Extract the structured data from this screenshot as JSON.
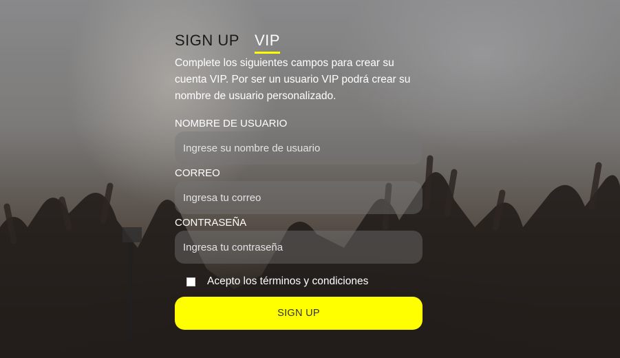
{
  "tabs": [
    {
      "label": "SIGN UP",
      "active": false
    },
    {
      "label": "VIP",
      "active": true
    }
  ],
  "description": "Complete los siguientes campos para crear su cuenta VIP. Por ser un usuario VIP podrá crear su nombre de usuario personalizado.",
  "fields": {
    "username": {
      "label": "NOMBRE DE USUARIO",
      "placeholder": "Ingrese su nombre de usuario",
      "value": ""
    },
    "email": {
      "label": "CORREO",
      "placeholder": "Ingresa tu correo",
      "value": ""
    },
    "password": {
      "label": "CONTRASEÑA",
      "placeholder": "Ingresa tu contraseña",
      "value": ""
    }
  },
  "terms": {
    "label": "Acepto los términos y condiciones",
    "checked": false
  },
  "submit_label": "SIGN UP",
  "colors": {
    "accent": "#ffff00",
    "button_text": "#333333"
  }
}
